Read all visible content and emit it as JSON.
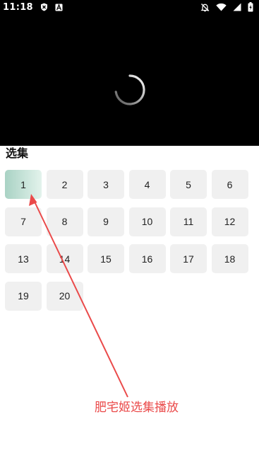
{
  "status_bar": {
    "time": "11:18",
    "left_icons": [
      "shield-icon",
      "a-badge-icon"
    ],
    "right_icons": [
      "bell-off-icon",
      "wifi-icon",
      "signal-icon",
      "battery-charging-icon"
    ]
  },
  "player": {
    "state": "loading",
    "spinner_icon": "loading-spinner-icon"
  },
  "episodes": {
    "title": "选集",
    "selected": "1",
    "items": [
      "1",
      "2",
      "3",
      "4",
      "5",
      "6",
      "7",
      "8",
      "9",
      "10",
      "11",
      "12",
      "13",
      "14",
      "15",
      "16",
      "17",
      "18",
      "19",
      "20"
    ]
  },
  "annotation": {
    "text": "肥宅姬选集播放",
    "color": "#ea4a4a"
  },
  "colors": {
    "player_background": "#000000",
    "episode_button": "#f0f0f0",
    "episode_selected_gradient": [
      "#a9d2c4",
      "#e3f3ec"
    ]
  }
}
